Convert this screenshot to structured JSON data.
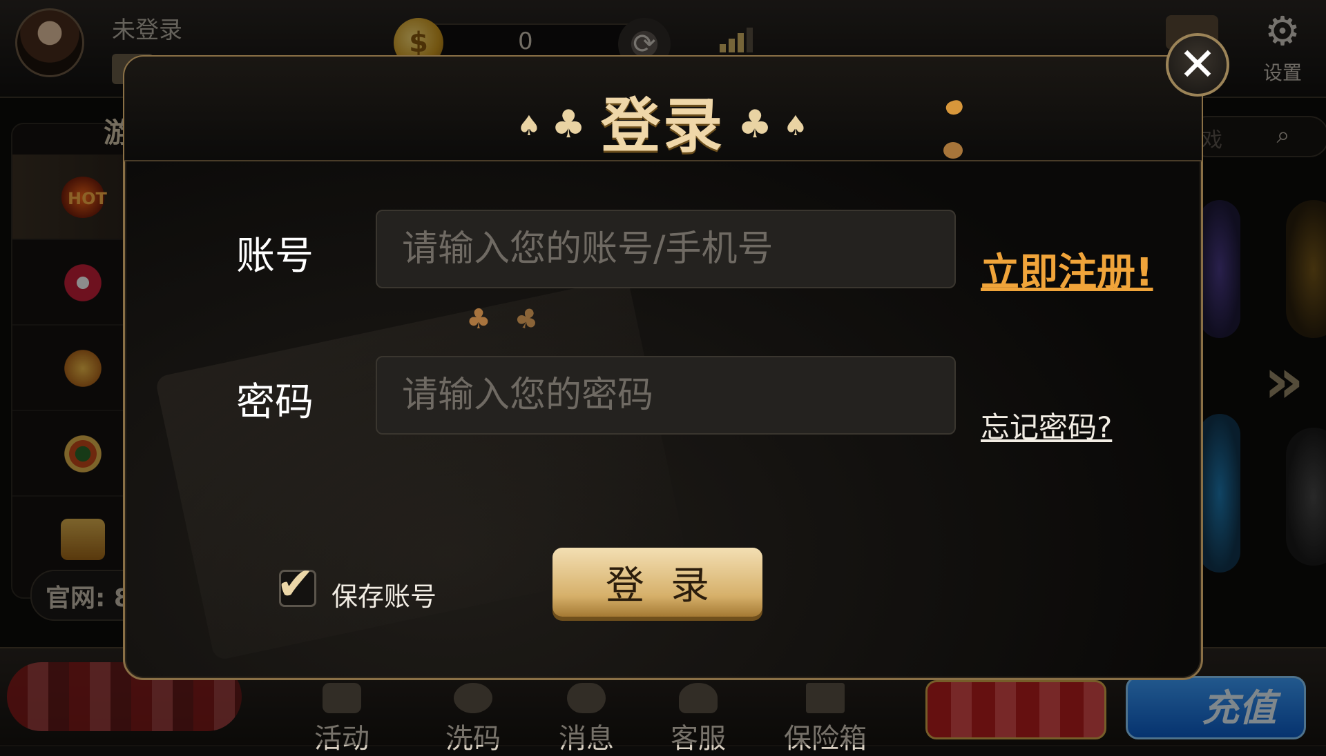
{
  "topbar": {
    "username": "未登录",
    "coins": "0",
    "settings_label": "设置"
  },
  "sidebar": {
    "title": "游",
    "hot_label": "HOT",
    "website_text": "官网: 8"
  },
  "search": {
    "placeholder": "戏"
  },
  "bottom_nav": {
    "items": [
      {
        "label": "活动",
        "icon": "gift-icon"
      },
      {
        "label": "洗码",
        "icon": "chip-icon"
      },
      {
        "label": "消息",
        "icon": "message-icon"
      },
      {
        "label": "客服",
        "icon": "support-icon"
      },
      {
        "label": "保险箱",
        "icon": "safe-icon"
      }
    ],
    "recharge_label": "充值"
  },
  "login_dialog": {
    "title": "登录",
    "title_suits": [
      "♠",
      "♣",
      "♣",
      "♠"
    ],
    "account_label": "账号",
    "account_placeholder": "请输入您的账号/手机号",
    "account_value": "",
    "password_label": "密码",
    "password_placeholder": "请输入您的密码",
    "password_value": "",
    "register_link": "立即注册!",
    "forgot_link": "忘记密码?",
    "save_account_label": "保存账号",
    "save_account_checked": true,
    "login_button": "登录",
    "close_symbol": "✕"
  },
  "colors": {
    "accent_gold": "#efd7a9",
    "register_orange": "#f0a43a",
    "dialog_border": "#8a7046"
  }
}
